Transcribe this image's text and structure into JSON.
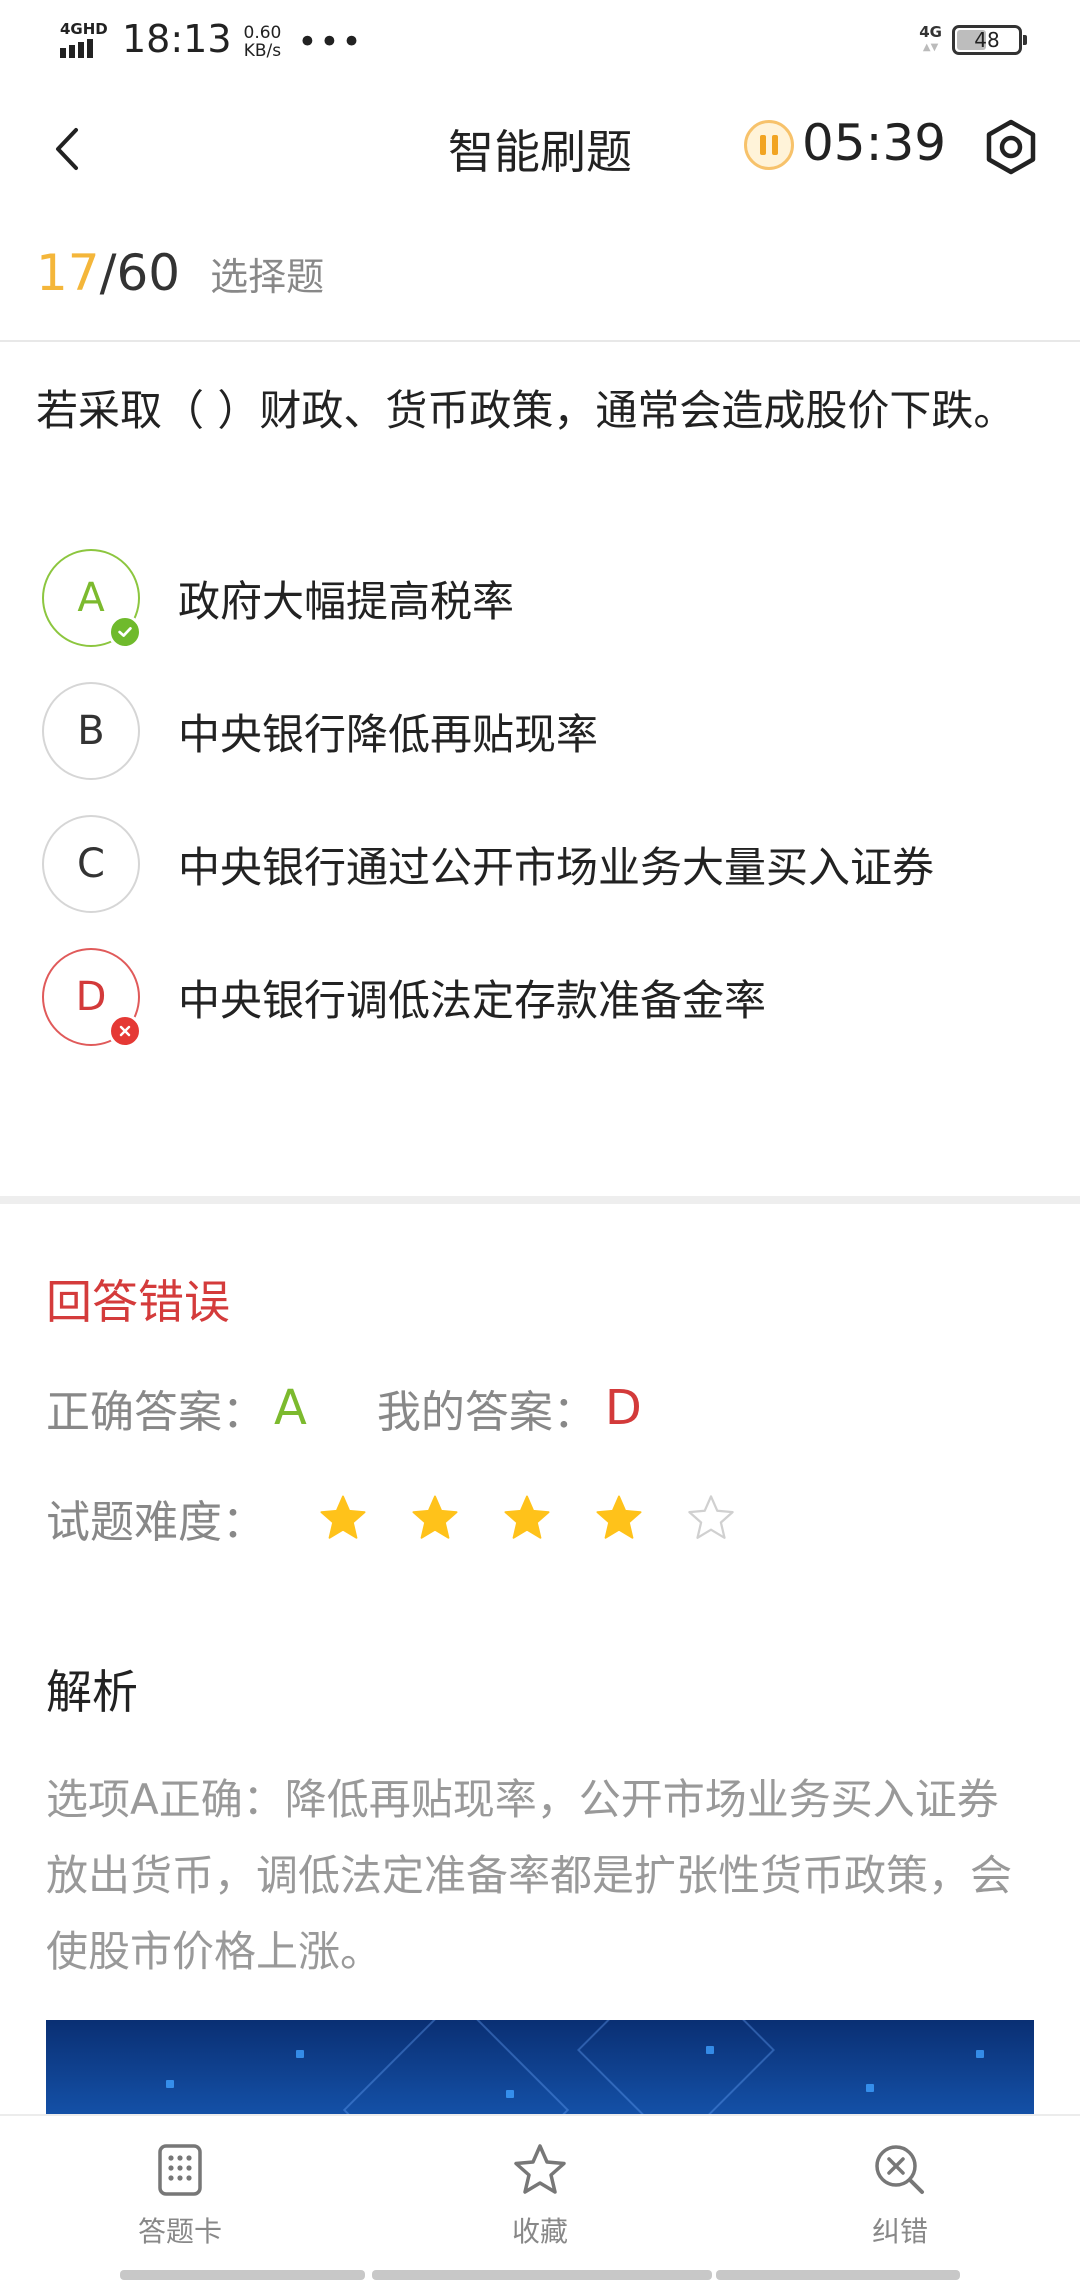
{
  "status_bar": {
    "network": "4GHD",
    "time": "18:13",
    "speed_value": "0.60",
    "speed_unit": "KB/s",
    "more": "•••",
    "right_network": "4G",
    "battery": "48"
  },
  "header": {
    "title": "智能刷题",
    "timer": "05:39",
    "icons": [
      "back-arrow-icon",
      "pause-icon",
      "settings-icon"
    ]
  },
  "progress": {
    "current": "17",
    "separator": "/",
    "total": "60",
    "question_type": "选择题"
  },
  "question": {
    "text": "若采取（ ）财政、货币政策，通常会造成股价下跌。",
    "options": [
      {
        "letter": "A",
        "text": "政府大幅提高税率",
        "state": "correct"
      },
      {
        "letter": "B",
        "text": "中央银行降低再贴现率",
        "state": "none"
      },
      {
        "letter": "C",
        "text": "中央银行通过公开市场业务大量买入证券",
        "state": "none"
      },
      {
        "letter": "D",
        "text": "中央银行调低法定存款准备金率",
        "state": "wrong"
      }
    ]
  },
  "result": {
    "title": "回答错误",
    "correct_label": "正确答案：",
    "correct_value": "A",
    "my_label": "我的答案：",
    "my_value": "D",
    "difficulty_label": "试题难度：",
    "difficulty_rating": 4,
    "difficulty_max": 5
  },
  "analysis": {
    "title": "解析",
    "text": "选项A正确：降低再贴现率，公开市场业务买入证券放出货币，调低法定准备率都是扩张性货币政策，会使股市价格上涨。"
  },
  "bottom_nav": [
    {
      "label": "答题卡",
      "icon": "answer-card-icon"
    },
    {
      "label": "收藏",
      "icon": "star-outline-icon"
    },
    {
      "label": "纠错",
      "icon": "search-error-icon"
    }
  ],
  "colors": {
    "accent_yellow": "#f4b63a",
    "correct_green": "#7cba2e",
    "wrong_red": "#d33a3a",
    "star_gold": "#ffc21a"
  }
}
